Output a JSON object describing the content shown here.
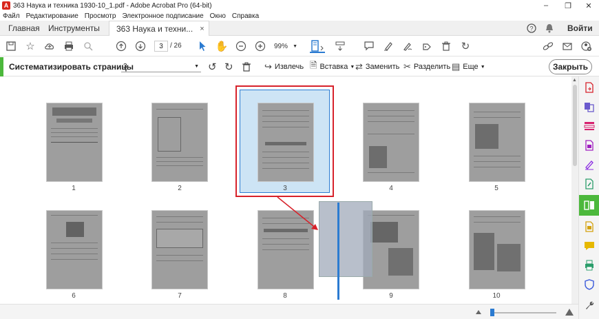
{
  "window": {
    "title": "363 Наука и техника 1930-10_1.pdf - Adobe Acrobat Pro (64-bit)",
    "app_icon": "acrobat-icon"
  },
  "menu": [
    "Файл",
    "Редактирование",
    "Просмотр",
    "Электронное подписание",
    "Окно",
    "Справка"
  ],
  "tabs": {
    "home": "Главная",
    "tools": "Инструменты",
    "doc": "363 Наука и техни...",
    "close": "×"
  },
  "account": {
    "signin": "Войти"
  },
  "toolbar": {
    "page_current": "3",
    "page_total": "/ 26",
    "zoom": "99%"
  },
  "organize": {
    "title": "Систематизировать страницы",
    "page_select": "3",
    "extract": "Извлечь",
    "insert": "Вставка",
    "replace": "Заменить",
    "split": "Разделить",
    "more": "Еще",
    "close": "Закрыть"
  },
  "pages": [
    {
      "label": "1"
    },
    {
      "label": "2"
    },
    {
      "label": "3"
    },
    {
      "label": "4"
    },
    {
      "label": "5"
    },
    {
      "label": "6"
    },
    {
      "label": "7"
    },
    {
      "label": "8"
    },
    {
      "label": "9"
    },
    {
      "label": "10"
    }
  ],
  "colors": {
    "selection_red": "#d7212a",
    "selection_blue": "#2b7bd1",
    "accent_green": "#4cb83c"
  }
}
